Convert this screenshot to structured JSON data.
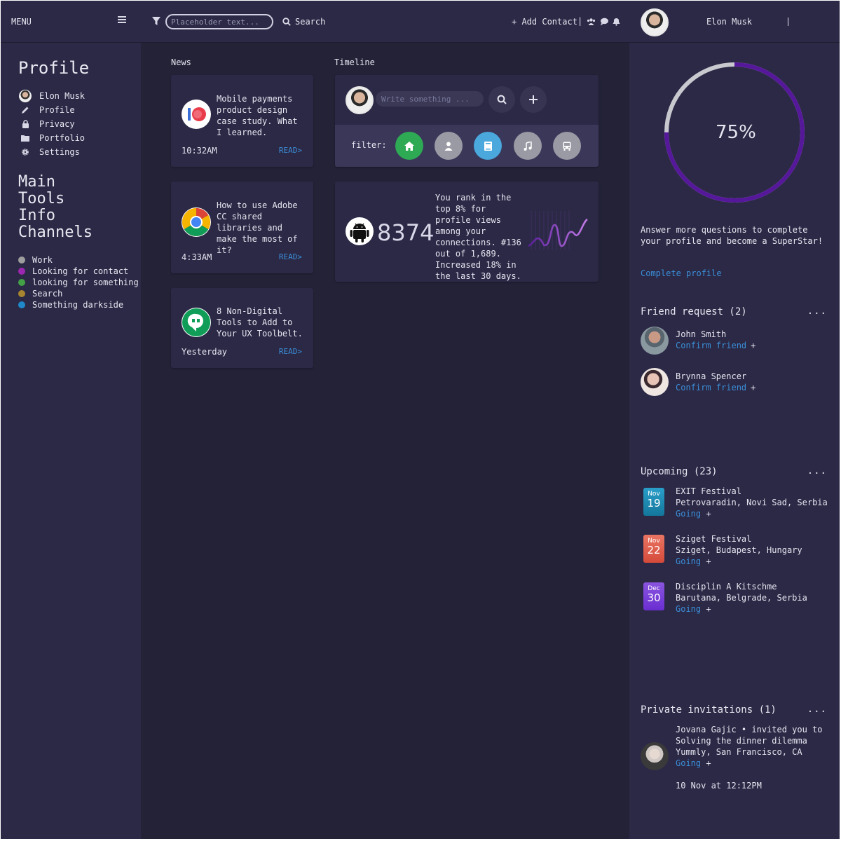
{
  "header": {
    "menu_label": "MENU",
    "search_placeholder": "Placeholder text...",
    "search_label": "Search",
    "add_contact_label": "+ Add Contact",
    "separator": "|",
    "user_name": "Elon Musk"
  },
  "sidebar": {
    "title": "Profile",
    "nav": [
      {
        "label": "Elon Musk",
        "icon": "user-avatar-icon"
      },
      {
        "label": "Profile",
        "icon": "pencil-icon"
      },
      {
        "label": "Privacy",
        "icon": "lock-icon"
      },
      {
        "label": "Portfolio",
        "icon": "folder-icon"
      },
      {
        "label": "Settings",
        "icon": "gear-icon"
      }
    ],
    "sections": [
      "Main",
      "Tools",
      "Info",
      "Channels"
    ],
    "legend": [
      {
        "label": "Work",
        "color": "#9e9e9e"
      },
      {
        "label": "Looking for contact",
        "color": "#9c27b0"
      },
      {
        "label": "looking for something",
        "color": "#43a047"
      },
      {
        "label": "Search",
        "color": "#a8862f"
      },
      {
        "label": "Something darkside",
        "color": "#1e88c8"
      }
    ]
  },
  "news": {
    "label": "News",
    "items": [
      {
        "text": "Mobile payments product design case study. What I learned.",
        "time": "10:32AM",
        "read": "READ>",
        "icon": "io-logo-icon"
      },
      {
        "text": "How to use Adobe CC shared libraries and make the most of it?",
        "time": "4:33AM",
        "read": "READ>",
        "icon": "chrome-icon"
      },
      {
        "text": "8 Non-Digital Tools to Add to Your UX Toolbelt.",
        "time": "Yesterday",
        "read": "READ>",
        "icon": "hangouts-icon"
      }
    ]
  },
  "timeline": {
    "label": "Timeline",
    "input_placeholder": "Write something ...",
    "filter_label": "filter:",
    "filters": [
      {
        "icon": "home-icon",
        "color": "#2eaa55"
      },
      {
        "icon": "person-icon",
        "color": "#9a9aa4"
      },
      {
        "icon": "book-icon",
        "color": "#4aa8dd"
      },
      {
        "icon": "music-icon",
        "color": "#9a9aa4"
      },
      {
        "icon": "bus-icon",
        "color": "#9a9aa4"
      }
    ],
    "stat_value": "8374",
    "stat_text": "You rank in the top 8% for profile views among your connections. #136 out of 1,689. Increased 18% in the last 30 days."
  },
  "right": {
    "progress_pct": 75,
    "progress_label": "75%",
    "progress_text": "Answer more questions to complete your profile and become a SuperStar!",
    "complete_link": "Complete profile",
    "friend_title": "Friend request (2)",
    "dots": "...",
    "friends": [
      {
        "name": "John Smith",
        "action": "Confirm friend",
        "plus": "+"
      },
      {
        "name": "Brynna Spencer",
        "action": "Confirm friend",
        "plus": "+"
      }
    ],
    "upcoming_title": "Upcoming (23)",
    "events": [
      {
        "month": "Nov",
        "day": "19",
        "title": "EXIT Festival",
        "place": "Petrovaradin, Novi Sad, Serbia",
        "going": "Going",
        "plus": "+",
        "color": "#1a8fb8"
      },
      {
        "month": "Nov",
        "day": "22",
        "title": "Sziget Festival",
        "place": "Sziget, Budapest, Hungary",
        "going": "Going",
        "plus": "+",
        "color": "#e0604f"
      },
      {
        "month": "Dec",
        "day": "30",
        "title": "Disciplin A Kitschme",
        "place": "Barutana, Belgrade, Serbia",
        "going": "Going",
        "plus": "+",
        "color": "#7b3fd8"
      }
    ],
    "invites_title": "Private invitations (1)",
    "invite": {
      "line1": "Jovana Gajic • invited you to",
      "line2": "Solving the dinner dilemma",
      "line3": "Yummly, San Francisco, CA",
      "going": "Going",
      "plus": "+",
      "date": "10 Nov at 12:12PM"
    }
  }
}
